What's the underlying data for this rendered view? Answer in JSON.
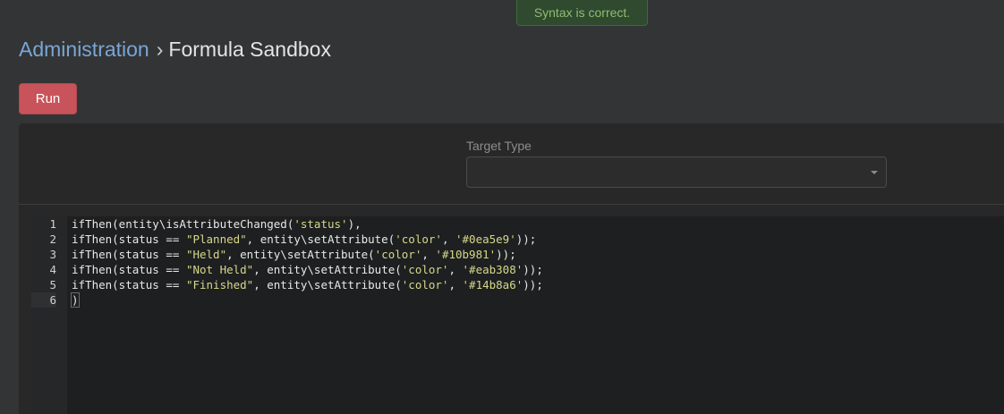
{
  "toast": {
    "message": "Syntax is correct."
  },
  "breadcrumb": {
    "parent": "Administration",
    "separator": "›",
    "current": "Formula Sandbox"
  },
  "toolbar": {
    "run_label": "Run"
  },
  "target_type": {
    "label": "Target Type",
    "value": ""
  },
  "editor": {
    "line_numbers": [
      "1",
      "2",
      "3",
      "4",
      "5",
      "6"
    ],
    "lines": [
      [
        {
          "t": "ifThen(entity\\isAttributeChanged(",
          "k": "p"
        },
        {
          "t": "'status'",
          "k": "s"
        },
        {
          "t": "),",
          "k": "p"
        }
      ],
      [
        {
          "t": "ifThen(status == ",
          "k": "p"
        },
        {
          "t": "\"Planned\"",
          "k": "s"
        },
        {
          "t": ", entity\\setAttribute(",
          "k": "p"
        },
        {
          "t": "'color'",
          "k": "s"
        },
        {
          "t": ", ",
          "k": "p"
        },
        {
          "t": "'#0ea5e9'",
          "k": "s"
        },
        {
          "t": "));",
          "k": "p"
        }
      ],
      [
        {
          "t": "ifThen(status == ",
          "k": "p"
        },
        {
          "t": "\"Held\"",
          "k": "s"
        },
        {
          "t": ", entity\\setAttribute(",
          "k": "p"
        },
        {
          "t": "'color'",
          "k": "s"
        },
        {
          "t": ", ",
          "k": "p"
        },
        {
          "t": "'#10b981'",
          "k": "s"
        },
        {
          "t": "));",
          "k": "p"
        }
      ],
      [
        {
          "t": "ifThen(status == ",
          "k": "p"
        },
        {
          "t": "\"Not Held\"",
          "k": "s"
        },
        {
          "t": ", entity\\setAttribute(",
          "k": "p"
        },
        {
          "t": "'color'",
          "k": "s"
        },
        {
          "t": ", ",
          "k": "p"
        },
        {
          "t": "'#eab308'",
          "k": "s"
        },
        {
          "t": "));",
          "k": "p"
        }
      ],
      [
        {
          "t": "ifThen(status == ",
          "k": "p"
        },
        {
          "t": "\"Finished\"",
          "k": "s"
        },
        {
          "t": ", entity\\setAttribute(",
          "k": "p"
        },
        {
          "t": "'color'",
          "k": "s"
        },
        {
          "t": ", ",
          "k": "p"
        },
        {
          "t": "'#14b8a6'",
          "k": "s"
        },
        {
          "t": "));",
          "k": "p"
        }
      ],
      [
        {
          "t": ")",
          "k": "c"
        }
      ]
    ]
  },
  "colors": {
    "background": "#333435",
    "accent_link": "#7aa6d6",
    "run_button": "#c9535a",
    "toast_bg": "#2f4a2f",
    "toast_text": "#8fbc6f",
    "string_literal": "#d6d88a"
  }
}
